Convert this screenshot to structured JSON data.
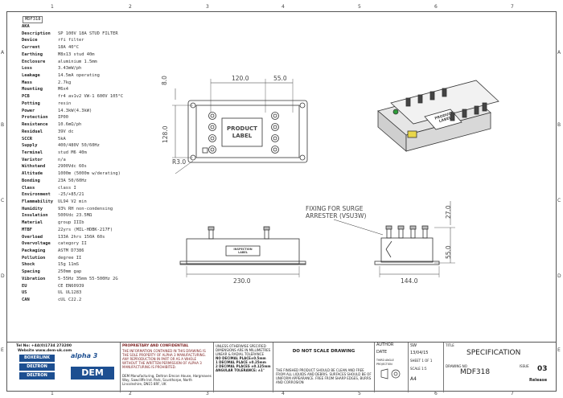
{
  "zones": {
    "columns": [
      "1",
      "2",
      "3",
      "4",
      "5",
      "6",
      "7"
    ],
    "rows": [
      "A",
      "B",
      "C",
      "D",
      "E"
    ]
  },
  "spec": {
    "title": "MDF318",
    "rows": [
      {
        "label": "AKA",
        "value": ""
      },
      {
        "label": "Description",
        "value": "SP 100V 18A STUD FILTER"
      },
      {
        "label": "Device",
        "value": "rfi filter"
      },
      {
        "label": "Current",
        "value": "18A 40°C"
      },
      {
        "label": "Earthing",
        "value": "M8x13 stud 40m"
      },
      {
        "label": "Enclosure",
        "value": "aluminium 1.5mm"
      },
      {
        "label": "Loss",
        "value": "3.43mW/ph"
      },
      {
        "label": "Leakage",
        "value": "14.5mA operating"
      },
      {
        "label": "Mass",
        "value": "2.7kg"
      },
      {
        "label": "Mounting",
        "value": "M6x4"
      },
      {
        "label": "PCB",
        "value": "fr4 av1v2 VW-1 600V 105°C"
      },
      {
        "label": "Potting",
        "value": "resin"
      },
      {
        "label": "Power",
        "value": "14.3kW(4.3kW)"
      },
      {
        "label": "Protection",
        "value": "IP00"
      },
      {
        "label": "Resistance",
        "value": "10.6mΩ/ph"
      },
      {
        "label": "Residual",
        "value": "39V dc"
      },
      {
        "label": "SCCR",
        "value": "5kA"
      },
      {
        "label": "Supply",
        "value": "400/480V 50/60Hz"
      },
      {
        "label": "Terminal",
        "value": "stud M6 40m"
      },
      {
        "label": "Varistor",
        "value": "n/a"
      },
      {
        "label": "Withstand",
        "value": "2900Vdc 60s"
      },
      {
        "label": "Altitude",
        "value": "1000m (5000m w/derating)"
      },
      {
        "label": "Bonding",
        "value": "23A 50/60Hz"
      },
      {
        "label": "Class",
        "value": "class I"
      },
      {
        "label": "Environment",
        "value": "-25/+85/21"
      },
      {
        "label": "Flammability",
        "value": "UL94 V2 min"
      },
      {
        "label": "Humidity",
        "value": "93% RH non-condensing"
      },
      {
        "label": "Insulation",
        "value": "500Vdc 23.5MΩ"
      },
      {
        "label": "Material",
        "value": "group IIIb"
      },
      {
        "label": "MTBF",
        "value": "22yrs (MIL-HDBK-217F)"
      },
      {
        "label": "Overload",
        "value": "133A 2hrs 150A 60s"
      },
      {
        "label": "Overvoltage",
        "value": "category II"
      },
      {
        "label": "Packaging",
        "value": "ASTM D7386"
      },
      {
        "label": "Pollution",
        "value": "degree II"
      },
      {
        "label": "Shock",
        "value": "15g 11mS"
      },
      {
        "label": "Spacing",
        "value": "250mm gap"
      },
      {
        "label": "Vibration",
        "value": "5-55Hz 35mm 55-500Hz 2G"
      },
      {
        "label": "EU",
        "value": "CE EN60939"
      },
      {
        "label": "US",
        "value": "UL UL1283"
      },
      {
        "label": "CAN",
        "value": "cUL C22.2"
      }
    ]
  },
  "drawing": {
    "dims": {
      "width_top": "120.0",
      "offset_right": "55.0",
      "offset_left": "8.0",
      "height_side": "128.0",
      "radius": "R3.0",
      "width_front": "230.0",
      "depth_side": "144.0",
      "height_side_top": "27.0",
      "height_side_body": "55.0"
    },
    "product_label": [
      "PRODUCT",
      "LABEL"
    ],
    "inspection_label": [
      "INSPECTION",
      "LABEL"
    ],
    "iso_label": [
      "PRODUCT",
      "LABEL"
    ],
    "surge_note": [
      "FIXING FOR SURGE",
      "ARRESTER (VSU3W)"
    ]
  },
  "titleblock": {
    "tel": "Tel No: +44(0)1734 273200",
    "website": "Website www.dem-uk.com",
    "brand1": "BOXERLINK",
    "brand2": "DELTRON",
    "brand3": "DELTRON",
    "brand_alpha": "alpha 3",
    "dem": "DEM",
    "proprietary_title": "PROPRIETARY AND CONFIDENTIAL",
    "proprietary_text": "THE INFORMATION CONTAINED IN THIS DRAWING IS THE SOLE PROPERTY OF ALPHA 3 MANUFACTURING. ANY REPRODUCTION IN PART OR AS A WHOLE WITHOUT THE WRITTEN PERMISSION OF ALPHA 3 MANUFACTURING IS PROHIBITED.",
    "address": "DEM Manufacturing, Deltron Emcon House, Hargreaves Way, Sawcliffe Ind. Park, Scunthorpe, North Lincolnshire, DN15 8RF, UK",
    "tolerance_head": "UNLESS OTHERWISE SPECIFIED DIMENSIONS ARE IN MILLIMETRES LINEAR & RADIAL TOLERANCE",
    "tol0": "NO DECIMAL PLACE±0.5mm",
    "tol1": "1 DECIMAL PLACE ±0.25mm",
    "tol2": "2 DECIMAL PLACES ±0.125mm",
    "tol_ang": "ANGULAR TOLERANCE: ±1°",
    "do_not_scale": "DO NOT SCALE DRAWING",
    "finish_note": "THE FINISHED PRODUCT SHOULD BE CLEAN AND FREE FROM ALL LIQUIDS AND DEBRIS. SURFACES SHOULD BE OF UNIFORM APPEARANCE. FREE FROM SHARP EDGES, BURRS AND CORROSION",
    "author_label": "AUTHOR",
    "author": "SW",
    "date_label": "DATE",
    "date": "13/04/15",
    "projection": "THIRD ANGLE PROJECTION",
    "sheet": "SHEET 1 OF 1",
    "scale": "SCALE 1:5",
    "size": "A4",
    "title_label": "TITLE",
    "title": "SPECIFICATION",
    "drawing_no_label": "DRAWING NO",
    "drawing_no": "MDF318",
    "issue_label": "ISSUE",
    "issue": "03",
    "release": "Release"
  }
}
